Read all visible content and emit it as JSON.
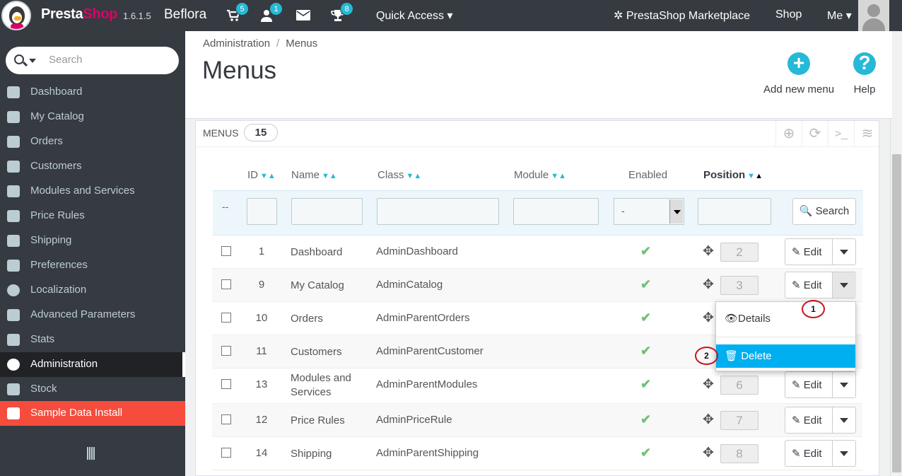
{
  "topbar": {
    "brand_a": "Presta",
    "brand_b": "Shop",
    "version": "1.6.1.5",
    "store_name": "Beflora",
    "badges": {
      "orders": "5",
      "customers": "1",
      "trophy": "8"
    },
    "quick_access": "Quick Access",
    "marketplace": "PrestaShop Marketplace",
    "shop": "Shop",
    "me": "Me"
  },
  "sidebar": {
    "search_placeholder": "Search",
    "items": [
      {
        "label": "Dashboard"
      },
      {
        "label": "My Catalog"
      },
      {
        "label": "Orders"
      },
      {
        "label": "Customers"
      },
      {
        "label": "Modules and Services"
      },
      {
        "label": "Price Rules"
      },
      {
        "label": "Shipping"
      },
      {
        "label": "Preferences"
      },
      {
        "label": "Localization"
      },
      {
        "label": "Advanced Parameters"
      },
      {
        "label": "Stats"
      },
      {
        "label": "Administration"
      },
      {
        "label": "Stock"
      },
      {
        "label": "Sample Data Install"
      }
    ]
  },
  "header": {
    "breadcrumb": [
      "Administration",
      "/",
      "Menus"
    ],
    "title": "Menus",
    "add_new": "Add new menu",
    "help": "Help"
  },
  "panel": {
    "title": "MENUS",
    "count": "15"
  },
  "table": {
    "columns": [
      "ID",
      "Name",
      "Class",
      "Module",
      "Enabled",
      "Position"
    ],
    "filter_dash": "--",
    "filter_select_value": "-",
    "search_button": "Search",
    "edit_label": "Edit",
    "rows": [
      {
        "id": "1",
        "name": "Dashboard",
        "class": "AdminDashboard",
        "position": "2"
      },
      {
        "id": "9",
        "name": "My Catalog",
        "class": "AdminCatalog",
        "position": "3"
      },
      {
        "id": "10",
        "name": "Orders",
        "class": "AdminParentOrders",
        "position": ""
      },
      {
        "id": "11",
        "name": "Customers",
        "class": "AdminParentCustomer",
        "position": ""
      },
      {
        "id": "13",
        "name": "Modules and Services",
        "class": "AdminParentModules",
        "position": "6"
      },
      {
        "id": "12",
        "name": "Price Rules",
        "class": "AdminPriceRule",
        "position": "7"
      },
      {
        "id": "14",
        "name": "Shipping",
        "class": "AdminParentShipping",
        "position": "8"
      }
    ]
  },
  "dropdown": {
    "details": "Details",
    "delete": "Delete"
  },
  "annotations": {
    "one": "1",
    "two": "2"
  },
  "colors": {
    "accent": "#25b9d7",
    "sample_data": "#f54c3e",
    "delete_highlight": "#00aff0"
  }
}
